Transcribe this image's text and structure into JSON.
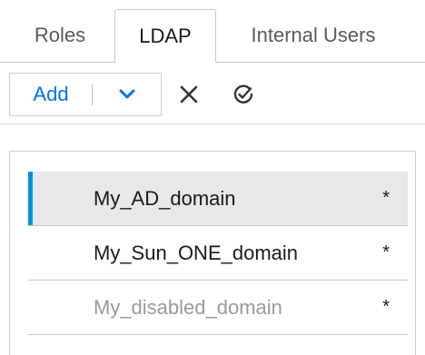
{
  "tabs": {
    "roles": "Roles",
    "ldap": "LDAP",
    "internal_users": "Internal Users",
    "active": "LDAP"
  },
  "toolbar": {
    "add_label": "Add",
    "dropdown_icon": "chevron-down-icon",
    "close_icon": "close-icon",
    "validate_icon": "check-circle-icon",
    "accent_color": "#0073e7"
  },
  "domains": {
    "items": [
      {
        "name": "My_AD_domain",
        "marker": "*",
        "state": "selected"
      },
      {
        "name": "My_Sun_ONE_domain",
        "marker": "*",
        "state": "normal"
      },
      {
        "name": "My_disabled_domain",
        "marker": "*",
        "state": "disabled"
      }
    ],
    "selection_color": "#0096d6"
  }
}
